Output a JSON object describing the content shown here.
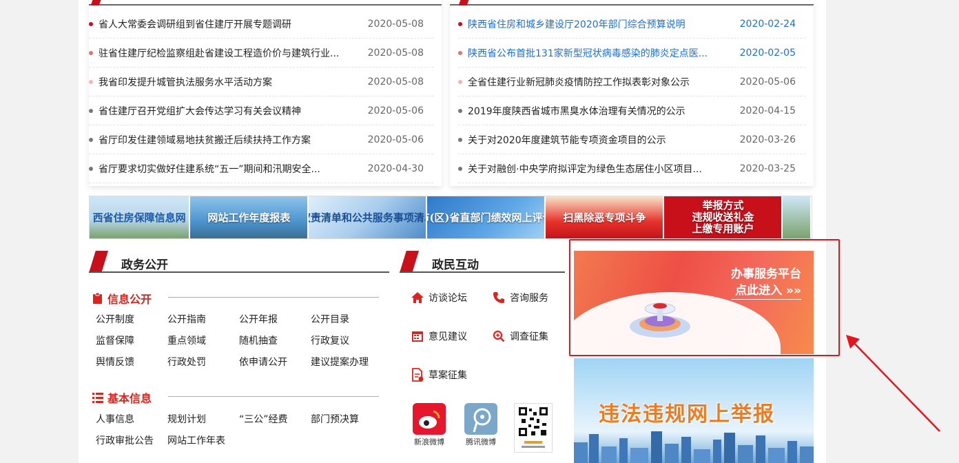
{
  "news_left": [
    {
      "title": "省人大常委会调研组到省住建厅开展专题调研",
      "date": "2020-05-08",
      "dot": "#c8101a"
    },
    {
      "title": "驻省住建厅纪检监察组赴省建设工程造价价与建筑行业...",
      "date": "2020-05-08",
      "dot": "#e87070"
    },
    {
      "title": "我省印发提升城管执法服务水平活动方案",
      "date": "2020-05-08",
      "dot": "#f3b4b4"
    },
    {
      "title": "省住建厅召开党组扩大会传达学习有关会议精神",
      "date": "2020-05-06",
      "dot": "#777777"
    },
    {
      "title": "省厅印发住建领域易地扶贫搬迁后续扶持工作方案",
      "date": "2020-05-06",
      "dot": "#777777"
    },
    {
      "title": "省厅要求切实做好住建系统“五一”期间和汛期安全...",
      "date": "2020-04-30",
      "dot": "#777777"
    }
  ],
  "news_right": [
    {
      "title": "陕西省住房和城乡建设厅2020年部门综合预算说明",
      "date": "2020-02-24",
      "dot": "#c8101a",
      "highlight": true
    },
    {
      "title": "陕西省公布首批131家新型冠状病毒感染的肺炎定点医...",
      "date": "2020-02-05",
      "dot": "#e87070",
      "highlight": true
    },
    {
      "title": "全省住建行业新冠肺炎疫情防控工作拟表彰对象公示",
      "date": "2020-05-06",
      "dot": "#f3b4b4",
      "highlight": false
    },
    {
      "title": "2019年度陕西省城市黑臭水体治理有关情况的公示",
      "date": "2020-04-15",
      "dot": "#777777",
      "highlight": false
    },
    {
      "title": "关于对2020年度建筑节能专项资金项目的公示",
      "date": "2020-03-26",
      "dot": "#777777",
      "highlight": false
    },
    {
      "title": "关于对融创·中央学府拟评定为绿色生态居住小区项目...",
      "date": "2020-03-25",
      "dot": "#777777",
      "highlight": false
    }
  ],
  "banners": {
    "b1": "西省住房保障信息网",
    "b2": "网站工作年度报表",
    "b3": "权责清单和公共服务事项清单",
    "b4": "市(区)省直部门绩效网上评议",
    "b5": "扫黑除恶专项斗争",
    "b6_l1": "举报方式",
    "b6_l2": "违规收送礼金",
    "b6_l3": "上缴专用账户"
  },
  "gov": {
    "title": "政务公开",
    "info_label": "信息公开",
    "info_links": [
      "公开制度",
      "公开指南",
      "公开年报",
      "公开目录",
      "监督保障",
      "重点领域",
      "随机抽查",
      "行政复议",
      "舆情反馈",
      "行政处罚",
      "依申请公开",
      "建议提案办理"
    ],
    "basic_label": "基本信息",
    "basic_links": [
      "人事信息",
      "规划计划",
      "“三公”经费",
      "部门预决算",
      "行政审批公告",
      "网站工作年表"
    ]
  },
  "interact": {
    "title": "政民互动",
    "forum": "访谈论坛",
    "consult": "咨询服务",
    "suggest": "意见建议",
    "survey": "调查征集",
    "draft": "草案征集",
    "sina": "新浪微博",
    "tencent": "腾讯微博"
  },
  "promo1": {
    "line1": "办事服务平台",
    "line2": "点此进入 »»"
  },
  "promo2": {
    "text": "违法违规网上举报"
  },
  "colors": {
    "red": "#c8101a",
    "blue": "#1d6fd1",
    "orange": "#f07a20"
  }
}
